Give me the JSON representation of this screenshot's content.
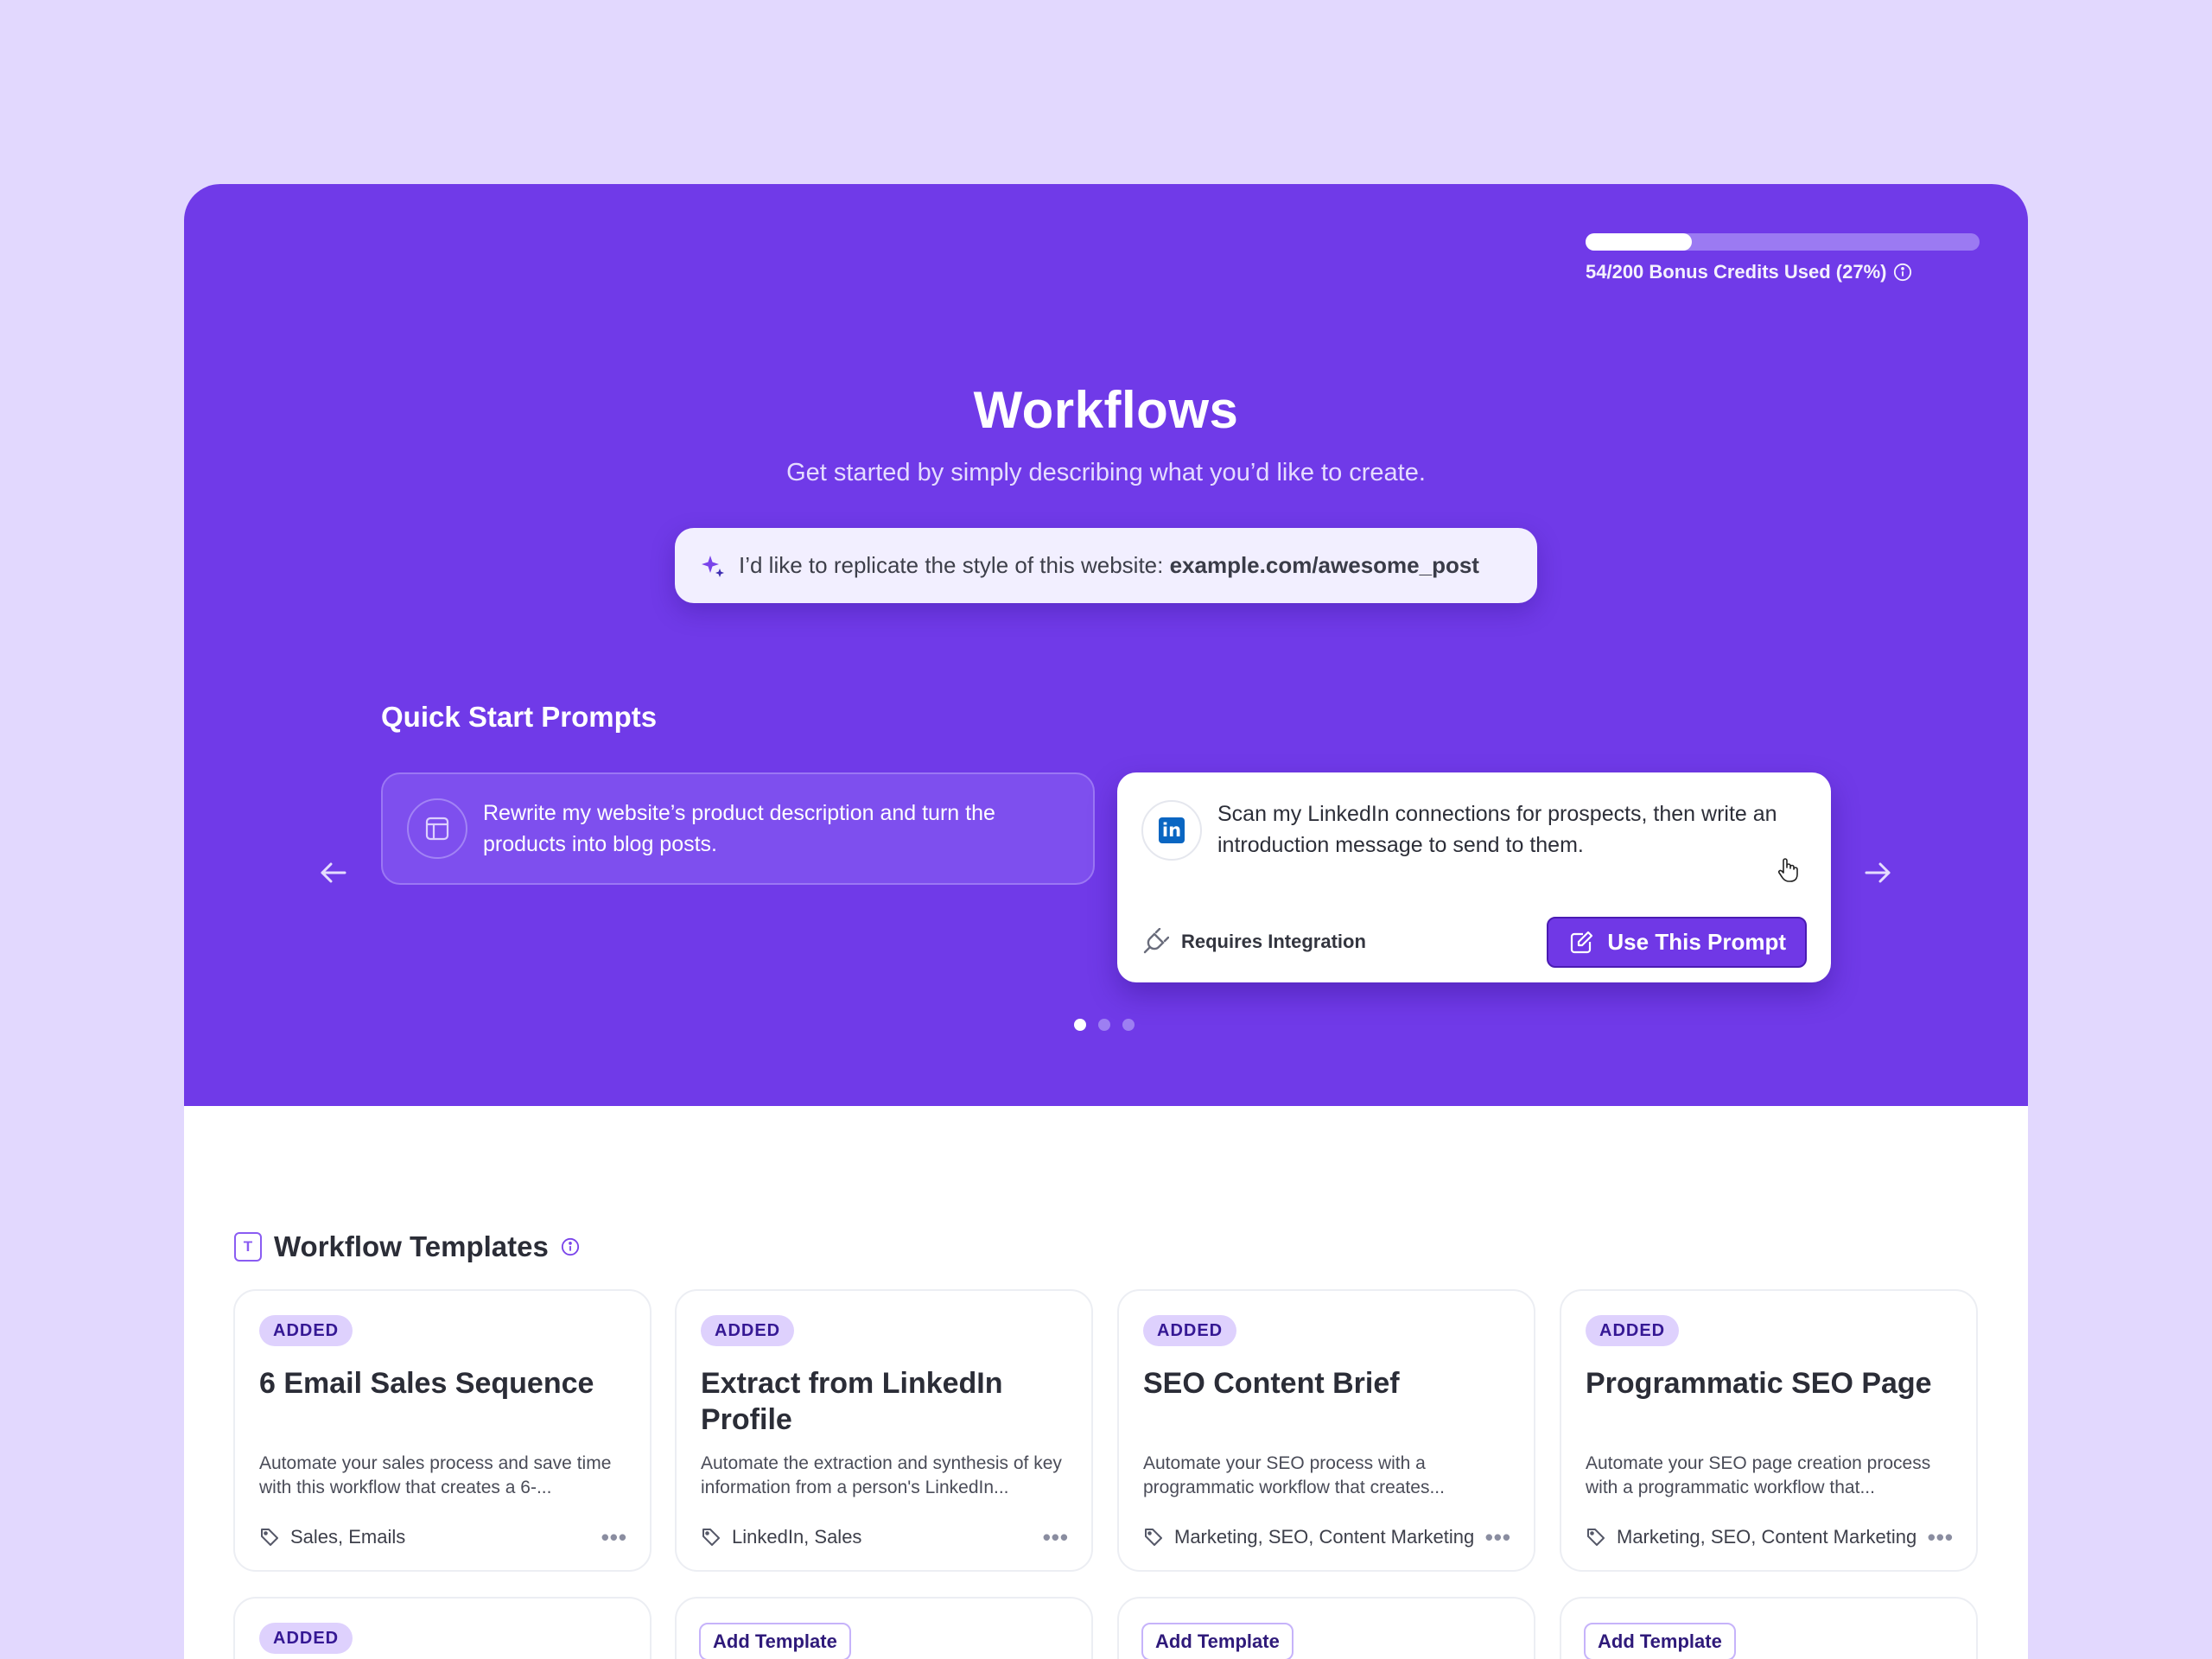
{
  "credits": {
    "label": "54/200 Bonus Credits Used (27%)",
    "used_fraction": 0.27
  },
  "hero": {
    "title": "Workflows",
    "subtitle": "Get started by simply describing what you’d like to create."
  },
  "search": {
    "prefix": "I’d like to replicate the style of this website: ",
    "highlight": "example.com/awesome_post",
    "icon": "sparkle-icon"
  },
  "quick_start": {
    "title": "Quick Start Prompts",
    "cards": [
      {
        "text": "Rewrite my website’s product description and turn the products into blog posts.",
        "icon": "layout-icon"
      },
      {
        "text": "Scan my LinkedIn connections for prospects, then write an introduction message to send to them.",
        "icon": "linkedin-icon",
        "logo_text": "in",
        "requirement": "Requires Integration",
        "button": "Use This Prompt"
      }
    ],
    "pagination": {
      "total": 3,
      "active": 1
    }
  },
  "templates": {
    "title": "Workflow Templates",
    "cards": [
      {
        "badge": "ADDED",
        "name": "6 Email Sales Sequence",
        "description": "Automate your sales process and save time with this workflow that creates a 6-...",
        "tags": "Sales, Emails"
      },
      {
        "badge": "ADDED",
        "name": "Extract from LinkedIn Profile",
        "description": "Automate the extraction and synthesis of key information from a person's LinkedIn...",
        "tags": "LinkedIn, Sales"
      },
      {
        "badge": "ADDED",
        "name": "SEO Content Brief",
        "description": "Automate your SEO process with a programmatic workflow that creates...",
        "tags": "Marketing, SEO, Content Marketing"
      },
      {
        "badge": "ADDED",
        "name": "Programmatic SEO Page",
        "description": "Automate your SEO page creation process with a programmatic workflow that...",
        "tags": "Marketing, SEO, Content Marketing"
      }
    ],
    "more_label": "•••",
    "second_row": [
      {
        "badge": "ADDED"
      },
      {
        "button": "Add Template"
      },
      {
        "button": "Add Template"
      },
      {
        "button": "Add Template"
      }
    ]
  },
  "colors": {
    "brand": "#703ae8",
    "page_bg": "#e2d8fe",
    "badge_bg": "#ded1fd"
  }
}
